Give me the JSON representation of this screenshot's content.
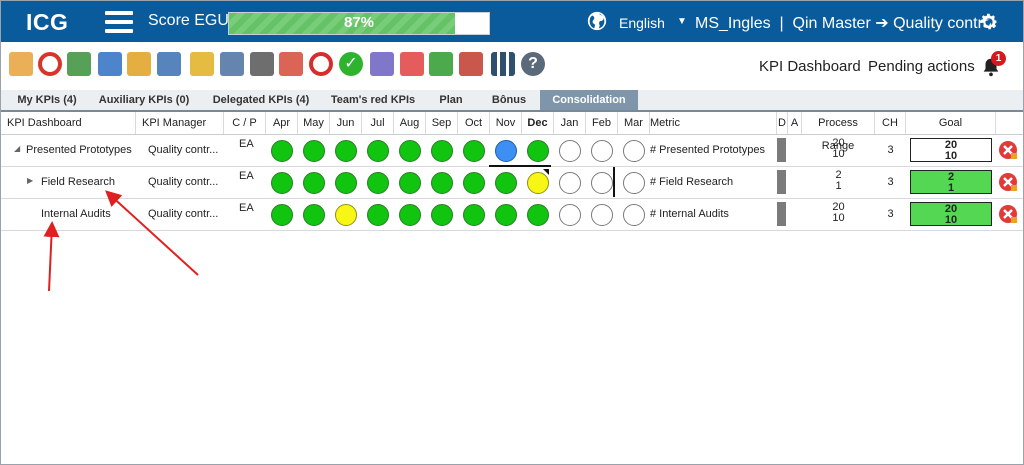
{
  "header": {
    "logo": "ICG",
    "score_label": "Score EGU:",
    "score_percent": "87%",
    "score_value": 0.87,
    "language": "English",
    "user": "MS_Ingles  |  Qin Master",
    "arrow": "➔",
    "module": "Quality control",
    "bg_color": "#0a5b9c"
  },
  "toolbar": {
    "icons": [
      "edit-icon",
      "target-icon",
      "clipboard-icon",
      "bar-chart-icon",
      "paperclip-icon",
      "team-icon",
      "medal-icon",
      "calendar-icon",
      "stopwatch-icon",
      "hierarchy-icon",
      "crosshair-icon",
      "check-circle-icon",
      "puzzle-icon",
      "pdf-icon",
      "alarm-off-icon",
      "presentation-icon",
      "grid-icon",
      "help-icon"
    ],
    "kpi_dashboard": "KPI Dashboard",
    "pending_actions": "Pending actions",
    "notification_count": "1"
  },
  "tabs": [
    "My KPIs (4)",
    "Auxiliary KPIs (0)",
    "Delegated KPIs (4)",
    "Team's red KPIs",
    "Plan",
    "Bônus",
    "Consolidation"
  ],
  "active_tab": "Consolidation",
  "table": {
    "headers": {
      "kpi": "KPI Dashboard",
      "manager": "KPI Manager",
      "cp": "C / P",
      "months": [
        "Apr",
        "May",
        "Jun",
        "Jul",
        "Aug",
        "Sep",
        "Oct",
        "Nov",
        "Dec",
        "Jan",
        "Feb",
        "Mar"
      ],
      "current_month": "Dec",
      "metric": "Metric",
      "d": "D",
      "a": "A",
      "process_range": "Process Range",
      "ch": "CH",
      "goal": "Goal"
    },
    "rows": [
      {
        "name": "Presented Prototypes",
        "expander": "◢",
        "manager": "Quality contr...",
        "cp": "EA",
        "status": [
          "green",
          "green",
          "green",
          "green",
          "green",
          "green",
          "green",
          "blue",
          "green",
          "empty",
          "empty",
          "empty"
        ],
        "metric": "# Presented Prototypes",
        "range_top": "20",
        "range_bottom": "10",
        "ch": "3",
        "goal_top": "20",
        "goal_bottom": "10",
        "goal_color": "white"
      },
      {
        "name": "Field Research",
        "expander": "▶",
        "manager": "Quality contr...",
        "cp": "EA",
        "status": [
          "green",
          "green",
          "green",
          "green",
          "green",
          "green",
          "green",
          "green",
          "yellow",
          "empty",
          "empty",
          "empty"
        ],
        "metric": "# Field Research",
        "range_top": "2",
        "range_bottom": "1",
        "ch": "3",
        "goal_top": "2",
        "goal_bottom": "1",
        "goal_color": "green"
      },
      {
        "name": "Internal Audits",
        "expander": "",
        "manager": "Quality contr...",
        "cp": "EA",
        "status": [
          "green",
          "green",
          "yellow",
          "green",
          "green",
          "green",
          "green",
          "green",
          "green",
          "empty",
          "empty",
          "empty"
        ],
        "metric": "# Internal Audits",
        "range_top": "20",
        "range_bottom": "10",
        "ch": "3",
        "goal_top": "20",
        "goal_bottom": "10",
        "goal_color": "green"
      }
    ]
  },
  "colors": {
    "status_green": "#11c40f",
    "status_blue": "#3d8ff3",
    "status_yellow": "#f8f615",
    "goal_green": "#54d854",
    "annotation_red": "#e02020"
  }
}
